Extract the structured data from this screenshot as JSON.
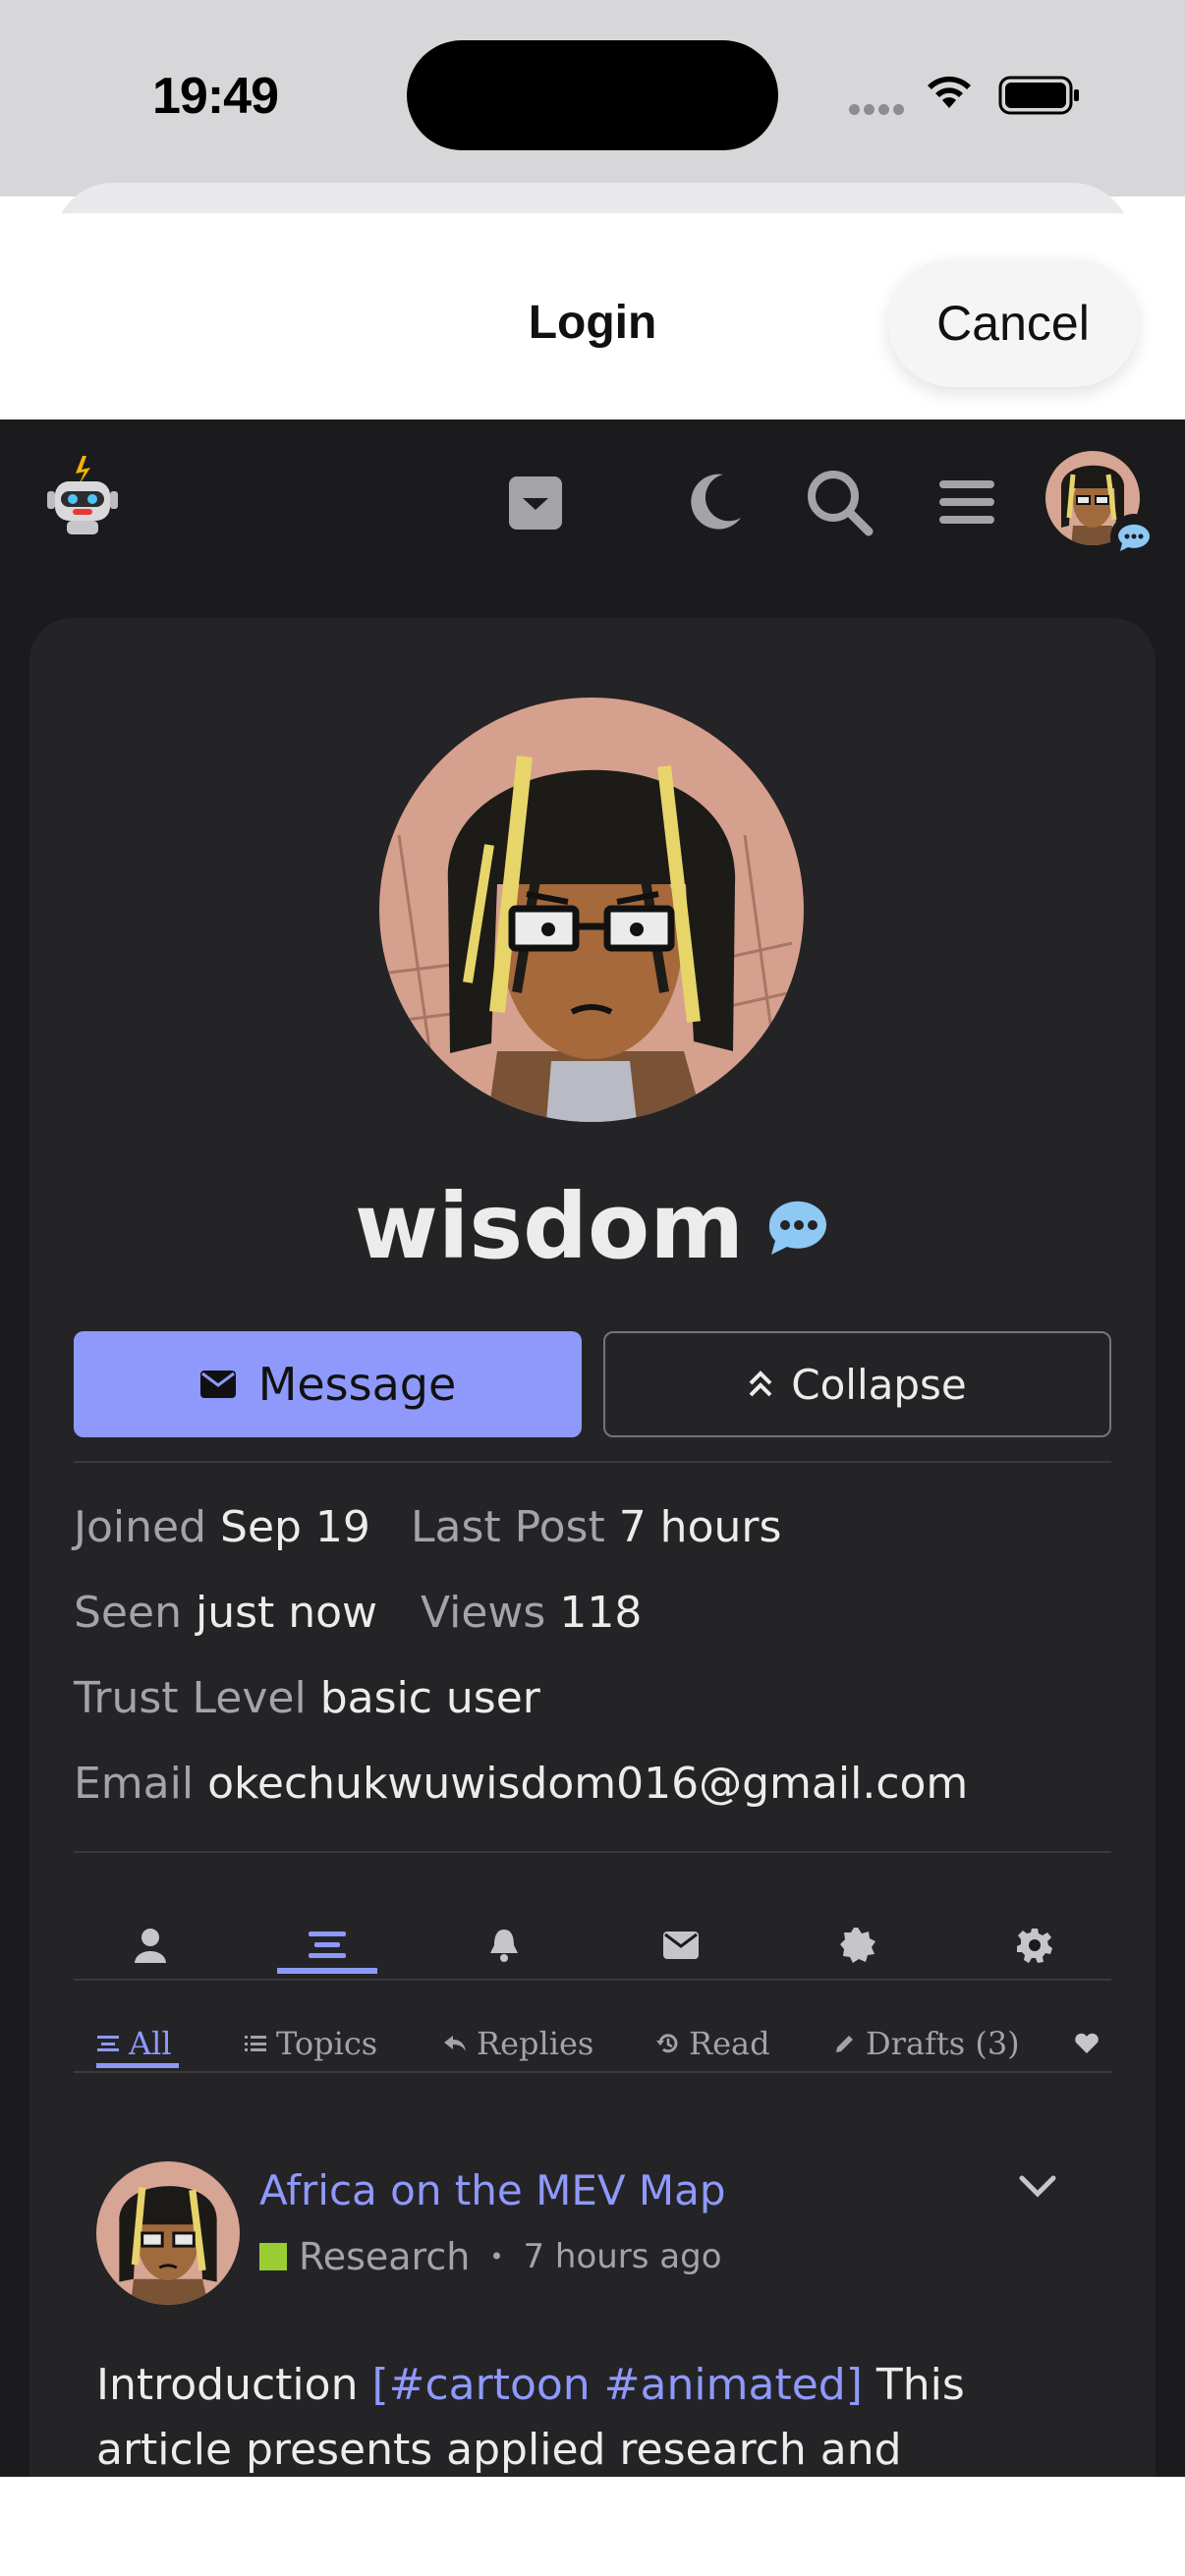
{
  "status_bar": {
    "time": "19:49"
  },
  "sheet": {
    "title": "Login",
    "cancel_label": "Cancel"
  },
  "profile": {
    "username": "wisdom",
    "message_label": "Message",
    "collapse_label": "Collapse",
    "stats": {
      "joined_label": "Joined",
      "joined_value": "Sep 19",
      "last_post_label": "Last Post",
      "last_post_value": "7 hours",
      "seen_label": "Seen",
      "seen_value": "just now",
      "views_label": "Views",
      "views_value": "118",
      "trust_label": "Trust Level",
      "trust_value": "basic user",
      "email_label": "Email",
      "email_value": "okechukwuwisdom016@gmail.com"
    }
  },
  "subtabs": {
    "all": "All",
    "topics": "Topics",
    "replies": "Replies",
    "read": "Read",
    "drafts": "Drafts (3)"
  },
  "post": {
    "title": "Africa on the MEV Map",
    "category": "Research",
    "category_color": "#9acd32",
    "separator": "•",
    "time": "7 hours ago",
    "excerpt_start": "Introduction ",
    "excerpt_tags": "[#cartoon #animated]",
    "excerpt_end": " This article presents applied research and engineering on"
  },
  "colors": {
    "accent": "#8f99fb",
    "background": "#1b1b1d",
    "card": "#242427"
  }
}
